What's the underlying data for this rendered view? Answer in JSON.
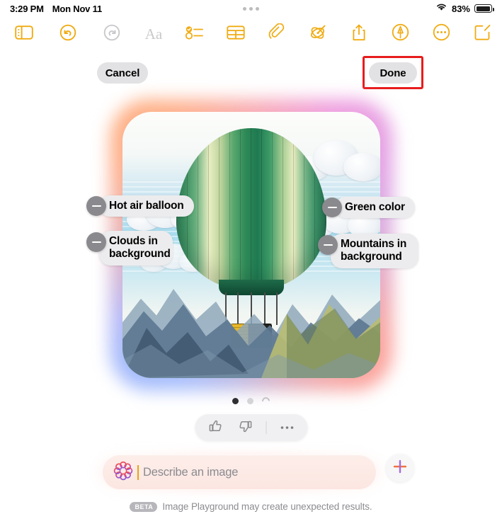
{
  "status_bar": {
    "time": "3:29 PM",
    "date": "Mon Nov 11",
    "battery_percent": "83%",
    "wifi_icon": "wifi-icon",
    "battery_icon": "battery-icon",
    "center_dots_icon": "more-dots-icon"
  },
  "toolbar": {
    "items": [
      {
        "name": "sidebar-toggle",
        "icon": "sidebar-icon",
        "state": "enabled"
      },
      {
        "name": "undo",
        "icon": "undo-icon",
        "state": "enabled"
      },
      {
        "name": "redo",
        "icon": "redo-icon",
        "state": "disabled"
      },
      {
        "name": "format-text",
        "icon": "aa-format-icon",
        "label": "Aa",
        "state": "disabled"
      },
      {
        "name": "checklist",
        "icon": "checklist-icon",
        "state": "enabled"
      },
      {
        "name": "table",
        "icon": "table-icon",
        "state": "enabled"
      },
      {
        "name": "attachment",
        "icon": "paperclip-icon",
        "state": "enabled"
      },
      {
        "name": "image-playground",
        "icon": "magic-wand-icon",
        "state": "enabled"
      },
      {
        "name": "share",
        "icon": "share-icon",
        "state": "enabled"
      },
      {
        "name": "markup",
        "icon": "markup-pen-icon",
        "state": "enabled"
      },
      {
        "name": "more-options",
        "icon": "ellipsis-circle-icon",
        "state": "enabled"
      },
      {
        "name": "compose",
        "icon": "compose-icon",
        "state": "enabled"
      }
    ]
  },
  "actions": {
    "cancel_label": "Cancel",
    "done_label": "Done",
    "highlight_color": "#e81c1c",
    "highlighted_button": "Done"
  },
  "image_card": {
    "subject": "Hot air balloon over mountains illustration",
    "chips": [
      {
        "id": "hot-air-balloon",
        "label": "Hot air balloon",
        "remove_icon": "minus-circle-icon"
      },
      {
        "id": "clouds",
        "label": "Clouds in background",
        "remove_icon": "minus-circle-icon"
      },
      {
        "id": "green-color",
        "label": "Green color",
        "remove_icon": "minus-circle-icon"
      },
      {
        "id": "mountains",
        "label": "Mountains in background",
        "remove_icon": "minus-circle-icon"
      }
    ]
  },
  "pagination": {
    "dots": [
      {
        "state": "active"
      },
      {
        "state": "inactive"
      },
      {
        "state": "loading"
      }
    ]
  },
  "feedback": {
    "thumbs_up_icon": "thumbs-up-icon",
    "thumbs_down_icon": "thumbs-down-icon",
    "more_icon": "ellipsis-icon"
  },
  "prompt": {
    "placeholder": "Describe an image",
    "value": "",
    "leading_icon": "image-playground-flower-icon",
    "add_icon": "plus-icon",
    "caret_color": "#e8a317"
  },
  "footer": {
    "badge": "BETA",
    "text": "Image Playground may create unexpected results."
  }
}
